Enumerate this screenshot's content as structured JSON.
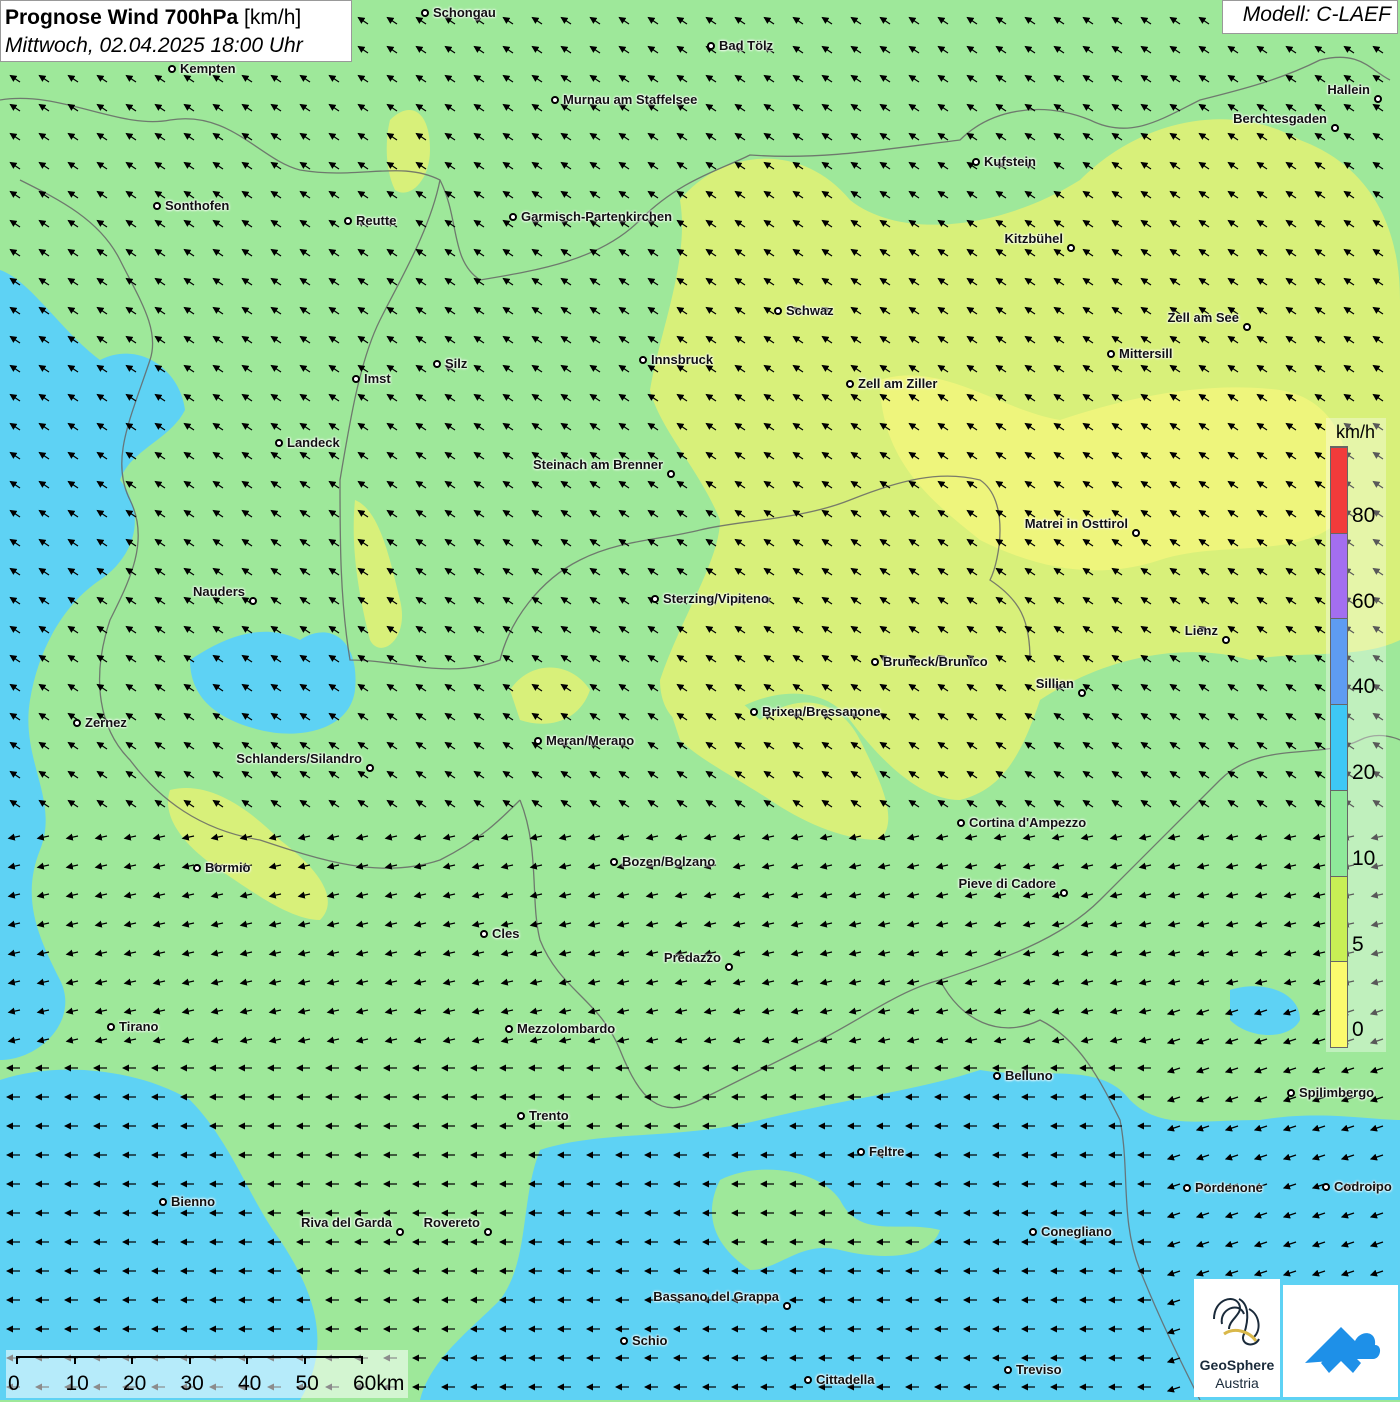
{
  "header": {
    "title_bold": "Prognose Wind 700hPa",
    "title_unit": "[km/h]",
    "datetime": "Mittwoch, 02.04.2025 18:00 Uhr",
    "model": "Modell: C-LAEF"
  },
  "legend": {
    "unit": "km/h",
    "labels": [
      "80",
      "60",
      "40",
      "20",
      "10",
      "5",
      "0"
    ],
    "colors": [
      "#f23b3b",
      "#a36ef0",
      "#5e9cf2",
      "#3ec8f5",
      "#8ee99a",
      "#c8ef55",
      "#fbfb6e"
    ]
  },
  "scale": {
    "labels": [
      "0",
      "10",
      "20",
      "30",
      "40",
      "50",
      "60km"
    ]
  },
  "logos": {
    "geosphere_line1": "GeoSphere",
    "geosphere_line2": "Austria"
  },
  "cities": [
    {
      "name": "Schongau"
    },
    {
      "name": "Kempten"
    },
    {
      "name": "Bad Tölz"
    },
    {
      "name": "Murnau am Staffelsee"
    },
    {
      "name": "Hallein"
    },
    {
      "name": "Berchtesgaden"
    },
    {
      "name": "Kufstein"
    },
    {
      "name": "Sonthofen"
    },
    {
      "name": "Reutte"
    },
    {
      "name": "Garmisch-Partenkirchen"
    },
    {
      "name": "Kitzbühel"
    },
    {
      "name": "Schwaz"
    },
    {
      "name": "Zell am See"
    },
    {
      "name": "Mittersill"
    },
    {
      "name": "Innsbruck"
    },
    {
      "name": "Silz"
    },
    {
      "name": "Imst"
    },
    {
      "name": "Zell am Ziller"
    },
    {
      "name": "Landeck"
    },
    {
      "name": "Steinach am Brenner"
    },
    {
      "name": "Matrei in Osttirol"
    },
    {
      "name": "Nauders"
    },
    {
      "name": "Sterzing/Vipiteno"
    },
    {
      "name": "Lienz"
    },
    {
      "name": "Bruneck/Brunico"
    },
    {
      "name": "Sillian"
    },
    {
      "name": "Zernez"
    },
    {
      "name": "Brixen/Bressanone"
    },
    {
      "name": "Meran/Merano"
    },
    {
      "name": "Schlanders/Silandro"
    },
    {
      "name": "Cortina d'Ampezzo"
    },
    {
      "name": "Bozen/Bolzano"
    },
    {
      "name": "Bormio"
    },
    {
      "name": "Pieve di Cadore"
    },
    {
      "name": "Cles"
    },
    {
      "name": "Predazzo"
    },
    {
      "name": "Tirano"
    },
    {
      "name": "Mezzolombardo"
    },
    {
      "name": "Belluno"
    },
    {
      "name": "Spilimbergo"
    },
    {
      "name": "Trento"
    },
    {
      "name": "Feltre"
    },
    {
      "name": "Bienno"
    },
    {
      "name": "Pordenone"
    },
    {
      "name": "Codroipo"
    },
    {
      "name": "Riva del Garda"
    },
    {
      "name": "Rovereto"
    },
    {
      "name": "Conegliano"
    },
    {
      "name": "Bassano del Grappa"
    },
    {
      "name": "Schio"
    },
    {
      "name": "Treviso"
    },
    {
      "name": "Cittadella"
    }
  ]
}
